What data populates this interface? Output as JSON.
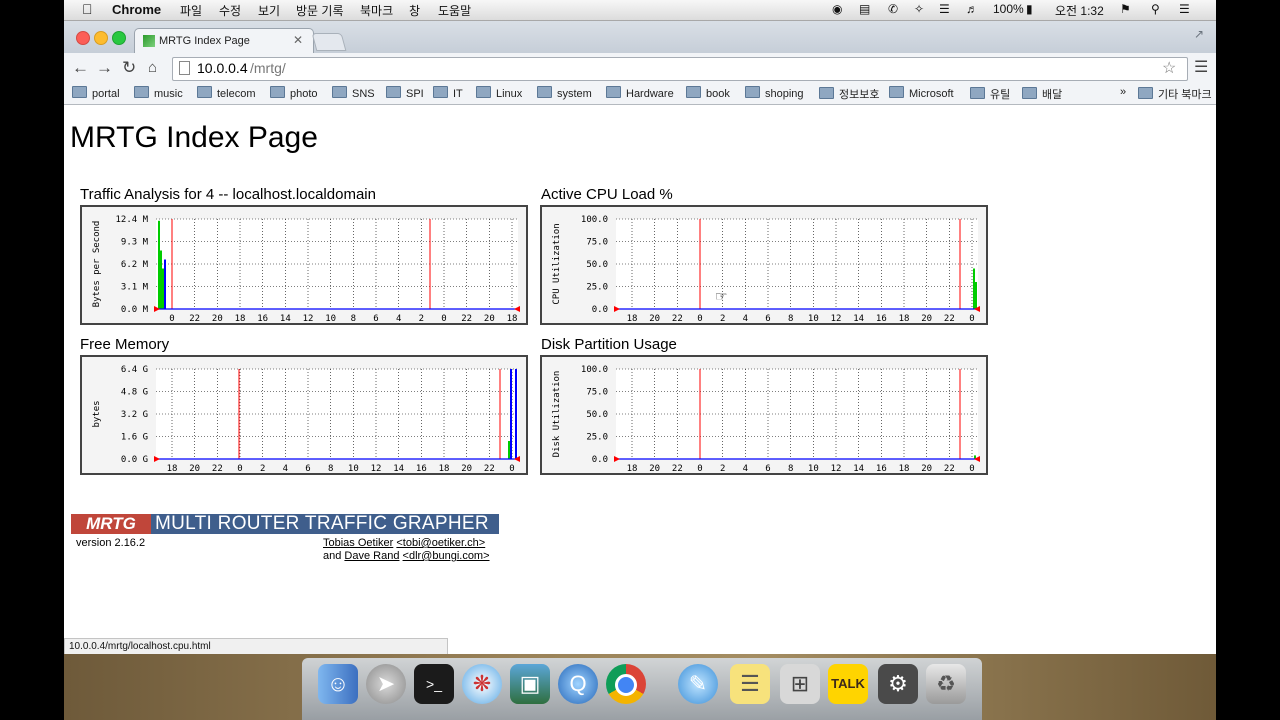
{
  "menubar": {
    "app": "Chrome",
    "menus": [
      "파일",
      "수정",
      "보기",
      "방문 기록",
      "북마크",
      "창",
      "도움말"
    ],
    "battery": "100%",
    "clock": "오전 1:32"
  },
  "tab": {
    "title": "MRTG Index Page"
  },
  "address": {
    "host": "10.0.0.4",
    "path": "/mrtg/"
  },
  "bookmarks": [
    "portal",
    "music",
    "telecom",
    "photo",
    "SNS",
    "SPI",
    "IT",
    "Linux",
    "system",
    "Hardware",
    "book",
    "shoping",
    "정보보호",
    "Microsoft",
    "유틸",
    "배달"
  ],
  "bookmarks_more": "»",
  "other_bookmarks": "기타 북마크",
  "page": {
    "title": "MRTG Index Page",
    "graphs": [
      {
        "title": "Traffic Analysis for 4 -- localhost.localdomain",
        "ylabel": "Bytes per Second",
        "yticks": [
          "12.4 M",
          "9.3 M",
          "6.2 M",
          "3.1 M",
          "0.0 M"
        ],
        "xticks": [
          "0",
          "22",
          "20",
          "18",
          "16",
          "14",
          "12",
          "10",
          "8",
          "6",
          "4",
          "2",
          "0",
          "22",
          "20",
          "18"
        ]
      },
      {
        "title": "Active CPU Load %",
        "ylabel": "CPU Utilization",
        "yticks": [
          "100.0",
          "75.0",
          "50.0",
          "25.0",
          "0.0"
        ],
        "xticks": [
          "18",
          "20",
          "22",
          "0",
          "2",
          "4",
          "6",
          "8",
          "10",
          "12",
          "14",
          "16",
          "18",
          "20",
          "22",
          "0"
        ]
      },
      {
        "title": "Free Memory",
        "ylabel": "bytes",
        "yticks": [
          "6.4 G",
          "4.8 G",
          "3.2 G",
          "1.6 G",
          "0.0 G"
        ],
        "xticks": [
          "18",
          "20",
          "22",
          "0",
          "2",
          "4",
          "6",
          "8",
          "10",
          "12",
          "14",
          "16",
          "18",
          "20",
          "22",
          "0"
        ]
      },
      {
        "title": "Disk Partition Usage",
        "ylabel": "Disk Utilization",
        "yticks": [
          "100.0",
          "75.0",
          "50.0",
          "25.0",
          "0.0"
        ],
        "xticks": [
          "18",
          "20",
          "22",
          "0",
          "2",
          "4",
          "6",
          "8",
          "10",
          "12",
          "14",
          "16",
          "18",
          "20",
          "22",
          "0"
        ]
      }
    ],
    "logo_short": "MRTG",
    "logo_long": "MULTI ROUTER TRAFFIC GRAPHER",
    "version": "version 2.16.2",
    "author1_name": "Tobias Oetiker",
    "author1_email": "<tobi@oetiker.ch>",
    "and": "and",
    "author2_name": "Dave Rand",
    "author2_email": "<dlr@bungi.com>"
  },
  "status_url": "10.0.0.4/mrtg/localhost.cpu.html",
  "colors": {
    "in": "#00cc00",
    "out": "#0000ff",
    "marker": "#ff0000",
    "grid": "#000000"
  }
}
